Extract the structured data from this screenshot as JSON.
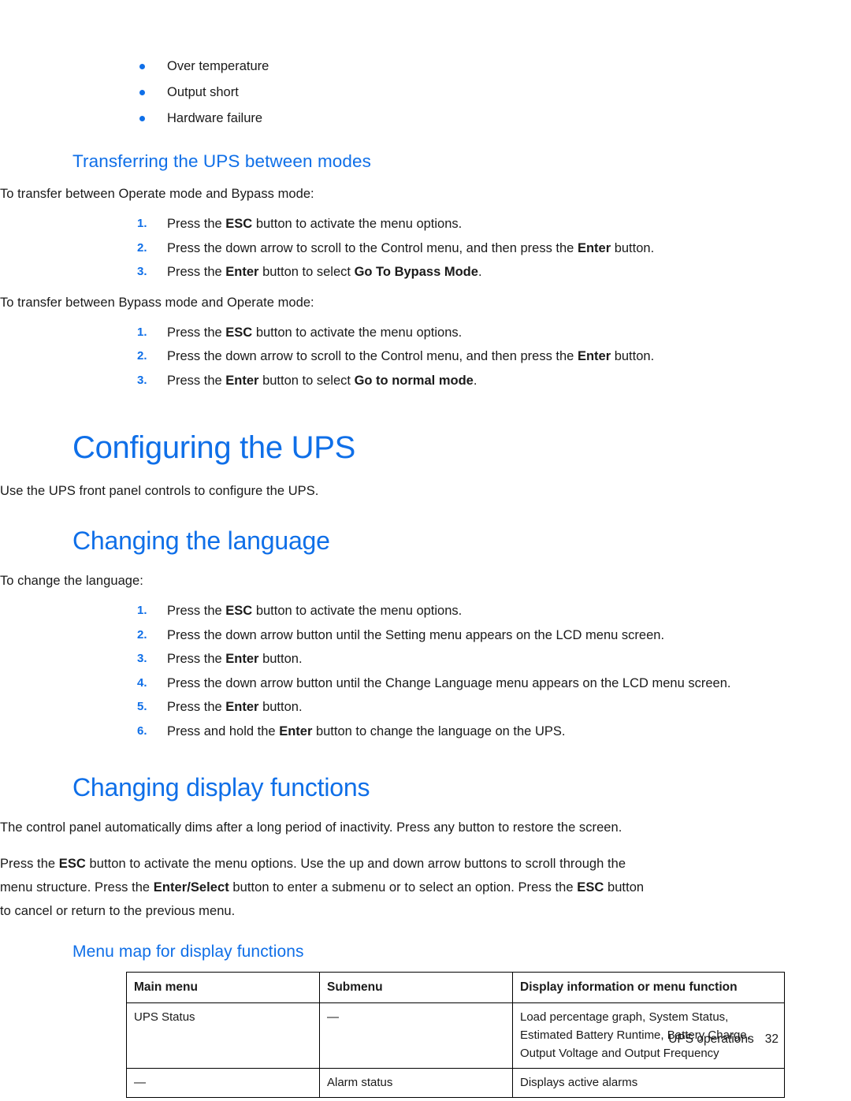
{
  "page": {
    "footer_label": "UPS operations",
    "page_number": "32",
    "accent_color": "#0F6FE8"
  },
  "top_bullets": [
    "Over temperature",
    "Output short",
    "Hardware failure"
  ],
  "transferring": {
    "heading": "Transferring the UPS between modes",
    "intro_1": "To transfer between Operate mode and Bypass mode:",
    "steps_1": [
      {
        "num": "1.",
        "a": "Press the ",
        "b1": "ESC",
        "c": " button to activate the menu options.",
        "b2": "",
        "d": ""
      },
      {
        "num": "2.",
        "a": "Press the down arrow to scroll to the Control menu, and then press the ",
        "b1": "Enter",
        "c": " button.",
        "b2": "",
        "d": ""
      },
      {
        "num": "3.",
        "a": "Press the ",
        "b1": "Enter",
        "c": " button to select ",
        "b2": "Go To Bypass Mode",
        "d": "."
      }
    ],
    "intro_2": "To transfer between Bypass mode and Operate mode:",
    "steps_2": [
      {
        "num": "1.",
        "a": "Press the ",
        "b1": "ESC",
        "c": " button to activate the menu options.",
        "b2": "",
        "d": ""
      },
      {
        "num": "2.",
        "a": "Press the down arrow to scroll to the Control menu, and then press the ",
        "b1": "Enter",
        "c": " button.",
        "b2": "",
        "d": ""
      },
      {
        "num": "3.",
        "a": "Press the ",
        "b1": "Enter",
        "c": " button to select ",
        "b2": "Go to normal mode",
        "d": "."
      }
    ]
  },
  "configuring": {
    "heading": "Configuring the UPS",
    "intro": "Use the UPS front panel controls to configure the UPS."
  },
  "changing_language": {
    "heading": "Changing the language",
    "intro": "To change the language:",
    "steps": [
      {
        "num": "1.",
        "a": "Press the ",
        "b1": "ESC",
        "c": " button to activate the menu options."
      },
      {
        "num": "2.",
        "a": "Press the down arrow button until the Setting menu appears on the LCD menu screen.",
        "b1": "",
        "c": ""
      },
      {
        "num": "3.",
        "a": "Press the ",
        "b1": "Enter",
        "c": " button."
      },
      {
        "num": "4.",
        "a": "Press the down arrow button until the Change Language menu appears on the LCD menu screen.",
        "b1": "",
        "c": ""
      },
      {
        "num": "5.",
        "a": "Press the ",
        "b1": "Enter",
        "c": " button."
      },
      {
        "num": "6.",
        "a": "Press and hold the ",
        "b1": "Enter",
        "c": " button to change the language on the UPS."
      }
    ]
  },
  "display_functions": {
    "heading": "Changing display functions",
    "para1": "The control panel automatically dims after a long period of inactivity. Press any button to restore the screen.",
    "para2": {
      "p1": "Press the ",
      "b1": "ESC",
      "p2": " button to activate the menu options. Use the up and down arrow buttons to scroll through the menu structure. Press the ",
      "b2": "Enter/Select",
      "p3": " button to enter a submenu or to select an option. Press the ",
      "b3": "ESC",
      "p4": " button to cancel or return to the previous menu."
    }
  },
  "menu_map": {
    "heading": "Menu map for display functions",
    "columns": [
      "Main menu",
      "Submenu",
      "Display information or menu function"
    ],
    "rows": [
      {
        "main": "UPS Status",
        "sub": "—",
        "display_lines": [
          "Load percentage graph, System Status,",
          "Estimated Battery Runtime, Battery Charge,",
          "Output Voltage and Output Frequency"
        ]
      },
      {
        "main": "—",
        "sub": "Alarm status",
        "display_lines": [
          "Displays active alarms"
        ]
      }
    ]
  }
}
